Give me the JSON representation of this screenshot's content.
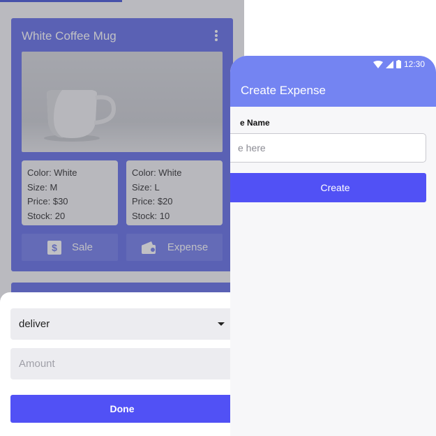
{
  "left_screen": {
    "product": {
      "title": "White Coffee Mug",
      "variants": [
        {
          "color": "Color: White",
          "size": "Size: M",
          "price": "Price: $30",
          "stock": "Stock: 20"
        },
        {
          "color": "Color: White",
          "size": "Size: L",
          "price": "Price: $20",
          "stock": "Stock: 10"
        }
      ],
      "actions": {
        "sale_label": "Sale",
        "expense_label": "Expense"
      }
    },
    "bottom_sheet": {
      "selected_type": "deliver",
      "amount_placeholder": "Amount",
      "done_label": "Done"
    }
  },
  "right_screen": {
    "status_time": "12:30",
    "title": "Create Expense",
    "field_label": "e Name",
    "name_placeholder": "e here",
    "create_label": "Create"
  },
  "colors": {
    "primary_button": "#5151f5",
    "header": "#7484f2",
    "card": "#5b67e6"
  },
  "icons": [
    "more-vert-icon",
    "dollar-icon",
    "wallet-icon",
    "dropdown-caret-icon",
    "wifi-icon",
    "signal-icon",
    "battery-icon"
  ]
}
